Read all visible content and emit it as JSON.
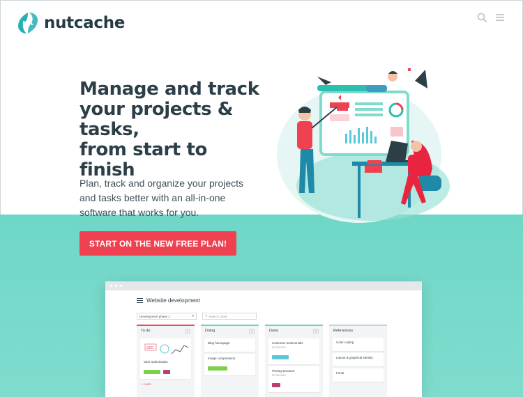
{
  "brand": {
    "name": "nutcache"
  },
  "header": {
    "icons": [
      "search-icon",
      "menu-icon"
    ]
  },
  "hero": {
    "title": "Manage and track\nyour projects &\ntasks,\nfrom start to finish",
    "subtitle": "Plan, track and organize your projects and tasks better with an all-in-one software that works for you.",
    "cta_label": "START ON THE NEW FREE PLAN!"
  },
  "colors": {
    "brand_teal": "#2bbfb0",
    "cta_red": "#ef4150",
    "heading": "#2c3f47",
    "band_teal": "#7fdccd"
  },
  "board": {
    "title": "Website development",
    "phase_select": "Development phase 1",
    "search_placeholder": "Search cards",
    "columns": [
      {
        "name": "To do",
        "count": "2",
        "cards": [
          {
            "title": "SEO optimization",
            "tags": [
              "#7ecf4a",
              "#b7436c"
            ]
          }
        ],
        "add_label": "+ CARD"
      },
      {
        "name": "Doing",
        "count": "3",
        "cards": [
          {
            "title": "Blog homepage"
          },
          {
            "title": "Image compression"
          }
        ]
      },
      {
        "name": "Done",
        "count": "2",
        "cards": [
          {
            "title": "Customer testimonials",
            "meta": "DD 05/07/19",
            "tags": [
              "#5bc7db"
            ]
          },
          {
            "title": "Pricing structure",
            "meta": "DD 05/15/19",
            "tags": [
              "#b7436c"
            ]
          }
        ]
      },
      {
        "name": "References",
        "count": "",
        "cards": [
          {
            "title": "Color coding"
          },
          {
            "title": "Layout & graphical identity"
          },
          {
            "title": "Fonts"
          }
        ]
      }
    ]
  }
}
